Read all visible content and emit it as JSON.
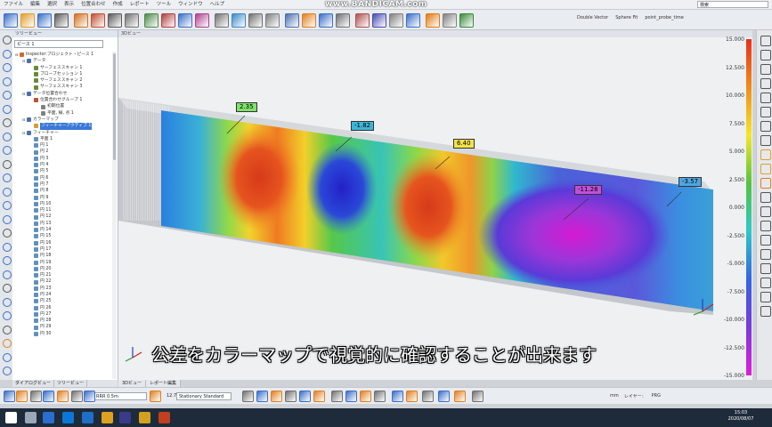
{
  "menu": [
    "ファイル",
    "編集",
    "選択",
    "表示",
    "位置合わせ",
    "作成",
    "レポート",
    "ツール",
    "ウィンドウ",
    "ヘルプ"
  ],
  "watermark": "www.BANDICAM.com",
  "search_placeholder": "検索",
  "toolbar_options": [
    "Double Vector",
    "Sphere Fit",
    "point_probe_time"
  ],
  "tree": {
    "header": "ツリービュー",
    "combo": "ピース 1",
    "items": [
      {
        "label": "Inspector:プロジェクト・ピース 1",
        "indent": 0,
        "icon": "#d06a2a"
      },
      {
        "label": "データ",
        "indent": 1,
        "icon": "#4a6fb0"
      },
      {
        "label": "サーフェススキャン 1",
        "indent": 2,
        "icon": "#6a8a3a"
      },
      {
        "label": "プローブセッション 1",
        "indent": 2,
        "icon": "#6a8a3a"
      },
      {
        "label": "サーフェススキャン 2",
        "indent": 2,
        "icon": "#6a8a3a"
      },
      {
        "label": "サーフェススキャン 3",
        "indent": 2,
        "icon": "#6a8a3a"
      },
      {
        "label": "データ位置合わせ",
        "indent": 1,
        "icon": "#4a6fb0"
      },
      {
        "label": "位置合わせグループ 1",
        "indent": 2,
        "icon": "#c05030"
      },
      {
        "label": "初期位置",
        "indent": 3,
        "icon": "#808080"
      },
      {
        "label": "平面, 線, 点 1",
        "indent": 3,
        "icon": "#808080"
      },
      {
        "label": "カラーマップ",
        "indent": 1,
        "icon": "#4a6fb0"
      },
      {
        "label": "フィーチャーアクティブ 1",
        "indent": 2,
        "icon": "#d0a030",
        "selected": true
      },
      {
        "label": "フィーチャー",
        "indent": 1,
        "icon": "#4a6fb0"
      },
      {
        "label": "平面 1",
        "indent": 2,
        "icon": "#6090c0"
      },
      {
        "label": "円 1",
        "indent": 2,
        "icon": "#6090c0"
      },
      {
        "label": "円 2",
        "indent": 2,
        "icon": "#6090c0"
      },
      {
        "label": "円 3",
        "indent": 2,
        "icon": "#6090c0"
      },
      {
        "label": "円 4",
        "indent": 2,
        "icon": "#6090c0"
      },
      {
        "label": "円 5",
        "indent": 2,
        "icon": "#6090c0"
      },
      {
        "label": "円 6",
        "indent": 2,
        "icon": "#6090c0"
      },
      {
        "label": "円 7",
        "indent": 2,
        "icon": "#6090c0"
      },
      {
        "label": "円 8",
        "indent": 2,
        "icon": "#6090c0"
      },
      {
        "label": "円 9",
        "indent": 2,
        "icon": "#6090c0"
      },
      {
        "label": "円 10",
        "indent": 2,
        "icon": "#6090c0"
      },
      {
        "label": "円 11",
        "indent": 2,
        "icon": "#6090c0"
      },
      {
        "label": "円 12",
        "indent": 2,
        "icon": "#6090c0"
      },
      {
        "label": "円 13",
        "indent": 2,
        "icon": "#6090c0"
      },
      {
        "label": "円 14",
        "indent": 2,
        "icon": "#6090c0"
      },
      {
        "label": "円 15",
        "indent": 2,
        "icon": "#6090c0"
      },
      {
        "label": "円 16",
        "indent": 2,
        "icon": "#6090c0"
      },
      {
        "label": "円 17",
        "indent": 2,
        "icon": "#6090c0"
      },
      {
        "label": "円 18",
        "indent": 2,
        "icon": "#6090c0"
      },
      {
        "label": "円 19",
        "indent": 2,
        "icon": "#6090c0"
      },
      {
        "label": "円 20",
        "indent": 2,
        "icon": "#6090c0"
      },
      {
        "label": "円 21",
        "indent": 2,
        "icon": "#6090c0"
      },
      {
        "label": "円 22",
        "indent": 2,
        "icon": "#6090c0"
      },
      {
        "label": "円 23",
        "indent": 2,
        "icon": "#6090c0"
      },
      {
        "label": "円 24",
        "indent": 2,
        "icon": "#6090c0"
      },
      {
        "label": "円 25",
        "indent": 2,
        "icon": "#6090c0"
      },
      {
        "label": "円 26",
        "indent": 2,
        "icon": "#6090c0"
      },
      {
        "label": "円 27",
        "indent": 2,
        "icon": "#6090c0"
      },
      {
        "label": "円 28",
        "indent": 2,
        "icon": "#6090c0"
      },
      {
        "label": "円 29",
        "indent": 2,
        "icon": "#6090c0"
      },
      {
        "label": "円 30",
        "indent": 2,
        "icon": "#6090c0"
      }
    ]
  },
  "viewport": {
    "header": "3Dビュー",
    "deviation_labels": [
      {
        "value": "2.35",
        "color": "#7de36a"
      },
      {
        "value": "-1.82",
        "color": "#3fb5d8"
      },
      {
        "value": "6.40",
        "color": "#f2e24a"
      },
      {
        "value": "-11.28",
        "color": "#c24fd8"
      },
      {
        "value": "-3.57",
        "color": "#4fa6e0"
      }
    ]
  },
  "colorbar": {
    "ticks": [
      "15.000",
      "12.500",
      "10.000",
      "7.500",
      "5.000",
      "2.500",
      "0.000",
      "-2.500",
      "-5.000",
      "-7.500",
      "-10.000",
      "-12.500",
      "-15.000"
    ],
    "colors": [
      "#e8301a",
      "#f08c1e",
      "#f5e62a",
      "#53c43e",
      "#2ec8c8",
      "#3366e0",
      "#7a3ad8",
      "#e01ed8"
    ]
  },
  "subtitle": "公差をカラーマップで視覚的に確認することが出来ます",
  "panel_tabs": [
    "ダイアログビュー",
    "ツリービュー"
  ],
  "view_tabs": [
    "3Dビュー",
    "レポート編集"
  ],
  "bottombar": {
    "select1": "RRR 0.5m",
    "value": "12.7",
    "select2": "Stationary Standard",
    "status": [
      "mm",
      "レイヤー：",
      "PRG"
    ]
  },
  "clock": {
    "time": "15:03",
    "date": "2020/08/07"
  }
}
